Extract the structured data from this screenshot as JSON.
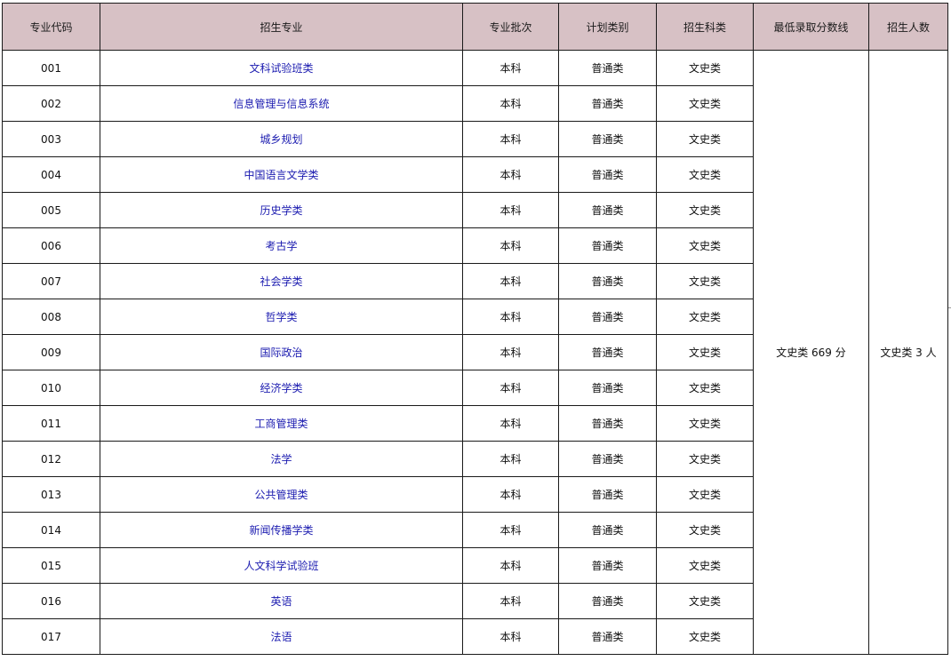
{
  "table": {
    "headers": {
      "code": "专业代码",
      "major": "招生专业",
      "batch": "专业批次",
      "plan_type": "计划类别",
      "subject": "招生科类",
      "min_score": "最低录取分数线",
      "enrollment": "招生人数"
    },
    "rows": [
      {
        "code": "001",
        "major": "文科试验班类",
        "batch": "本科",
        "plan_type": "普通类",
        "subject": "文史类"
      },
      {
        "code": "002",
        "major": "信息管理与信息系统",
        "batch": "本科",
        "plan_type": "普通类",
        "subject": "文史类"
      },
      {
        "code": "003",
        "major": "城乡规划",
        "batch": "本科",
        "plan_type": "普通类",
        "subject": "文史类"
      },
      {
        "code": "004",
        "major": "中国语言文学类",
        "batch": "本科",
        "plan_type": "普通类",
        "subject": "文史类"
      },
      {
        "code": "005",
        "major": "历史学类",
        "batch": "本科",
        "plan_type": "普通类",
        "subject": "文史类"
      },
      {
        "code": "006",
        "major": "考古学",
        "batch": "本科",
        "plan_type": "普通类",
        "subject": "文史类"
      },
      {
        "code": "007",
        "major": "社会学类",
        "batch": "本科",
        "plan_type": "普通类",
        "subject": "文史类"
      },
      {
        "code": "008",
        "major": "哲学类",
        "batch": "本科",
        "plan_type": "普通类",
        "subject": "文史类"
      },
      {
        "code": "009",
        "major": "国际政治",
        "batch": "本科",
        "plan_type": "普通类",
        "subject": "文史类"
      },
      {
        "code": "010",
        "major": "经济学类",
        "batch": "本科",
        "plan_type": "普通类",
        "subject": "文史类"
      },
      {
        "code": "011",
        "major": "工商管理类",
        "batch": "本科",
        "plan_type": "普通类",
        "subject": "文史类"
      },
      {
        "code": "012",
        "major": "法学",
        "batch": "本科",
        "plan_type": "普通类",
        "subject": "文史类"
      },
      {
        "code": "013",
        "major": "公共管理类",
        "batch": "本科",
        "plan_type": "普通类",
        "subject": "文史类"
      },
      {
        "code": "014",
        "major": "新闻传播学类",
        "batch": "本科",
        "plan_type": "普通类",
        "subject": "文史类"
      },
      {
        "code": "015",
        "major": "人文科学试验班",
        "batch": "本科",
        "plan_type": "普通类",
        "subject": "文史类"
      },
      {
        "code": "016",
        "major": "英语",
        "batch": "本科",
        "plan_type": "普通类",
        "subject": "文史类"
      },
      {
        "code": "017",
        "major": "法语",
        "batch": "本科",
        "plan_type": "普通类",
        "subject": "文史类"
      }
    ],
    "merged": {
      "min_score": "文史类 669 分",
      "enrollment": "文史类 3 人"
    }
  },
  "colors": {
    "header_bg": "#d7c1c5",
    "major_text": "#1c1cb0",
    "border": "#1a1a1a"
  }
}
